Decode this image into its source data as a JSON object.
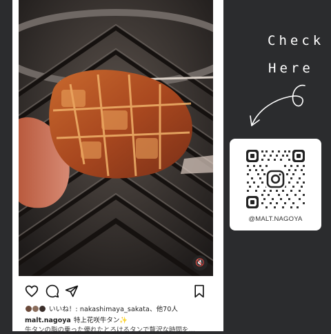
{
  "post": {
    "likes_text": "いいね！: nakashimaya_sakata、他70人",
    "account": "malt.nagoya",
    "caption": "特上花咲牛タン✨",
    "caption_line2": "牛タンの脂の乗った優れたとろけるタンで贅沢な時間を…",
    "icons": [
      "heart-icon",
      "comment-icon",
      "share-icon",
      "bookmark-icon",
      "mute-icon"
    ]
  },
  "promo": {
    "check": "Check",
    "here": "Here",
    "qr_handle": "@MALT.NAGOYA"
  },
  "colors": {
    "background": "#2b2c2e",
    "card": "#ffffff",
    "text": "#222222"
  }
}
